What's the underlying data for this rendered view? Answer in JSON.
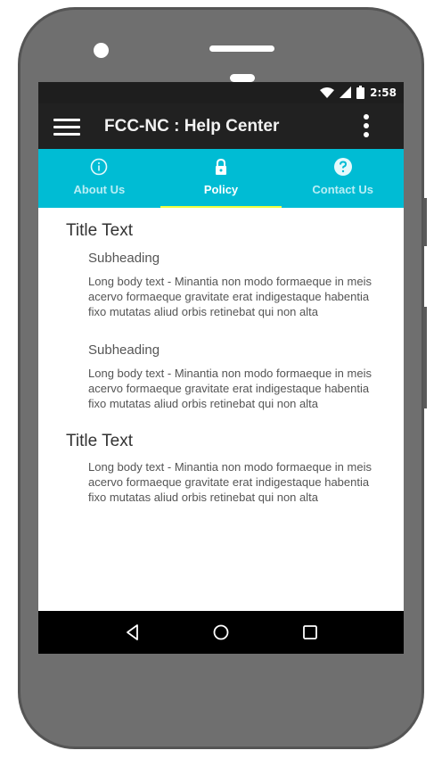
{
  "status_bar": {
    "time": "2:58",
    "icons": [
      "wifi-icon",
      "signal-icon",
      "battery-icon"
    ]
  },
  "app_bar": {
    "title": "FCC-NC : Help Center",
    "menu_icon": "hamburger-menu-icon",
    "more_icon": "more-vert-icon"
  },
  "tabs": [
    {
      "label": "About Us",
      "icon": "info-icon",
      "active": false
    },
    {
      "label": "Policy",
      "icon": "lock-icon",
      "active": true
    },
    {
      "label": "Contact Us",
      "icon": "help-icon",
      "active": false
    }
  ],
  "content": {
    "sections": [
      {
        "title": "Title Text",
        "subsections": [
          {
            "subheading": "Subheading",
            "body": "Long body text - Minantia non modo formaeque in meis acervo formaeque gravitate erat indigestaque habentia fixo mutatas aliud orbis retinebat qui non alta"
          },
          {
            "subheading": "Subheading",
            "body": "Long body text - Minantia non modo formaeque in meis acervo formaeque gravitate erat indigestaque habentia fixo mutatas aliud orbis retinebat qui non alta"
          }
        ]
      },
      {
        "title": "Title Text",
        "body": "Long body text - Minantia non modo formaeque in meis acervo formaeque gravitate erat indigestaque habentia fixo mutatas aliud orbis retinebat qui non alta"
      }
    ]
  },
  "nav_bar": {
    "icons": [
      "back-icon",
      "home-icon",
      "recents-icon"
    ]
  },
  "colors": {
    "tab_bar": "#00bcd4",
    "app_bar": "#212121",
    "indicator": "#eeff41",
    "status_bar": "#1e1e1e",
    "phone_body": "#6f6f6f"
  }
}
